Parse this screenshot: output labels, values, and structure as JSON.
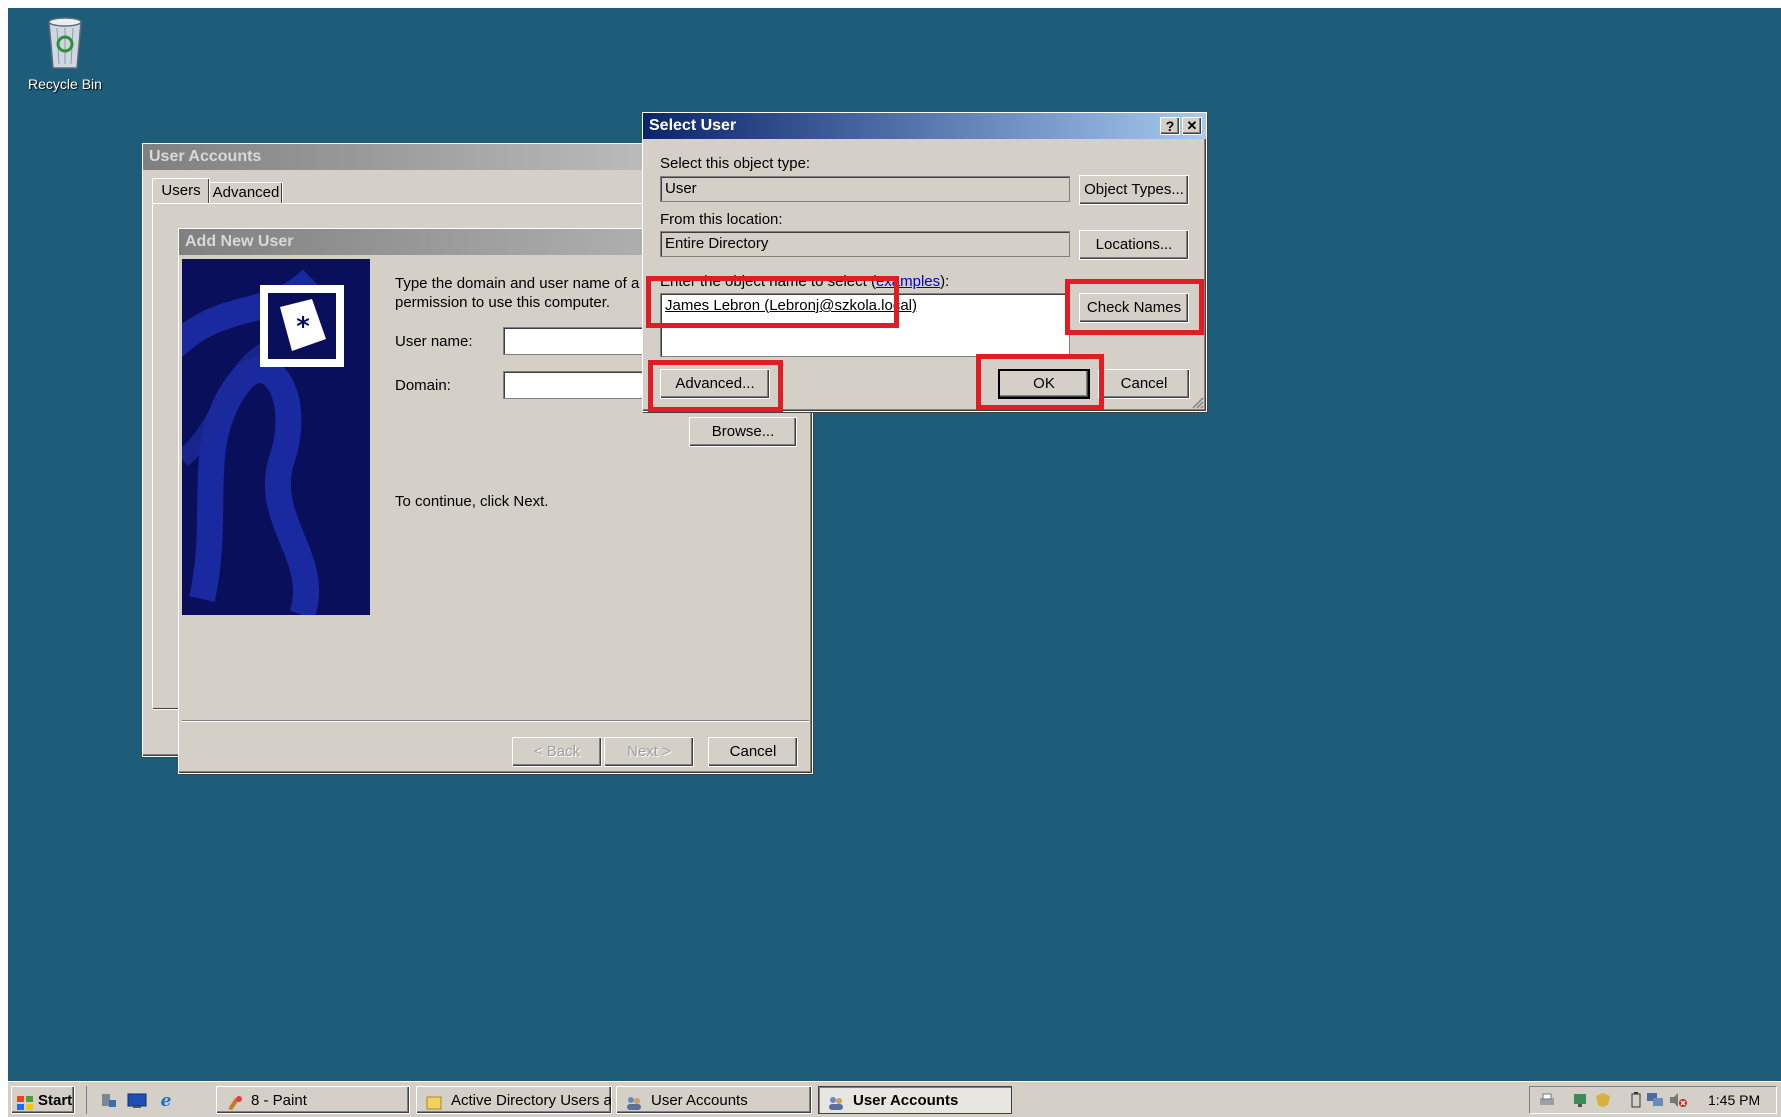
{
  "desktop": {
    "background": "#1e5d7a",
    "icons": [
      {
        "label": "Recycle Bin",
        "icon": "recycle-bin-icon"
      }
    ]
  },
  "user_accounts": {
    "title": "User Accounts",
    "tabs": [
      {
        "label": "Users",
        "selected": true
      },
      {
        "label": "Advanced",
        "selected": false
      }
    ]
  },
  "add_new_user": {
    "title": "Add New User",
    "instruction_line1": "Type the domain and user name of a u",
    "instruction_line2": "permission to use this computer.",
    "user_name_label": "User name:",
    "user_name_value": "",
    "domain_label": "Domain:",
    "domain_value": "",
    "browse_label": "Browse...",
    "continue_text": "To continue, click Next.",
    "back_label": "< Back",
    "next_label": "Next >",
    "cancel_label": "Cancel"
  },
  "select_user": {
    "title": "Select User",
    "help_glyph": "?",
    "close_glyph": "✕",
    "object_type_label": "Select this object type:",
    "object_type_value": "User",
    "object_types_button": "Object Types...",
    "location_label": "From this location:",
    "location_value": "Entire Directory",
    "locations_button": "Locations...",
    "object_name_label_prefix": "Enter the object name to select (",
    "object_name_link": "examples",
    "object_name_label_suffix": "):",
    "object_name_value": "James Lebron (Lebronj@szkola.local)",
    "check_names_button": "Check Names",
    "advanced_button": "Advanced...",
    "ok_button": "OK",
    "cancel_button": "Cancel"
  },
  "highlight_color": "#e01c24",
  "taskbar": {
    "start_label": "Start",
    "quick_launch": [
      "server-manager-icon",
      "show-desktop-icon",
      "internet-explorer-icon"
    ],
    "buttons": [
      {
        "label": "8 - Paint",
        "icon": "paint-icon",
        "active": false
      },
      {
        "label": "Active Directory Users a...",
        "icon": "active-directory-icon",
        "active": false
      },
      {
        "label": "User Accounts",
        "icon": "user-accounts-icon",
        "active": false
      },
      {
        "label": "User Accounts",
        "icon": "user-accounts-icon",
        "active": true
      }
    ],
    "tray_icons": [
      "printer-icon",
      "network-icon",
      "security-icon",
      "battery-icon",
      "network-connections-icon",
      "volume-muted-icon"
    ],
    "clock": "1:45 PM"
  }
}
